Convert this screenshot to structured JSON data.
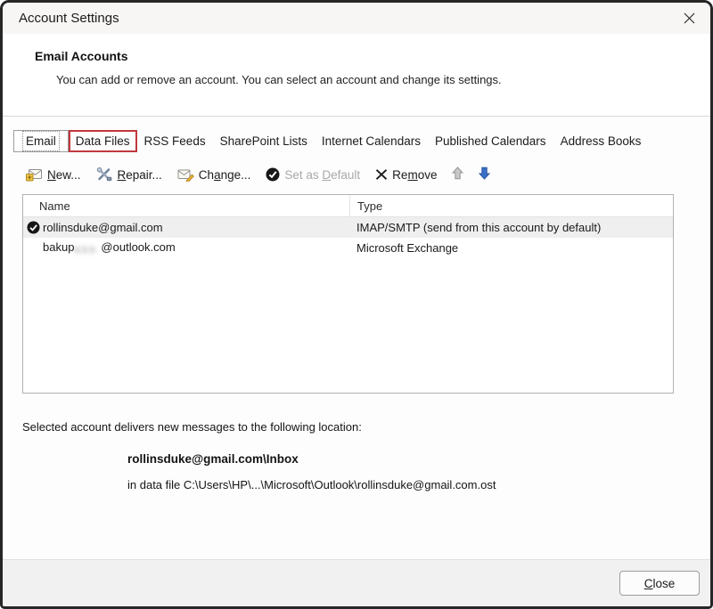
{
  "window": {
    "title": "Account Settings"
  },
  "header": {
    "title": "Email Accounts",
    "description": "You can add or remove an account. You can select an account and change its settings."
  },
  "tabs": [
    {
      "label": "Email",
      "selected": true
    },
    {
      "label": "Data Files",
      "annotated": true
    },
    {
      "label": "RSS Feeds"
    },
    {
      "label": "SharePoint Lists"
    },
    {
      "label": "Internet Calendars"
    },
    {
      "label": "Published Calendars"
    },
    {
      "label": "Address Books"
    }
  ],
  "toolbar": {
    "buttons": [
      {
        "pre": "",
        "key": "N",
        "post": "ew...",
        "icon": "new-account-icon",
        "enabled": true
      },
      {
        "pre": "",
        "key": "R",
        "post": "epair...",
        "icon": "repair-icon",
        "enabled": true
      },
      {
        "pre": "Ch",
        "key": "a",
        "post": "nge...",
        "icon": "change-icon",
        "enabled": true
      },
      {
        "pre": "Set as ",
        "key": "D",
        "post": "efault",
        "icon": "set-default-icon",
        "enabled": false
      },
      {
        "pre": "Re",
        "key": "m",
        "post": "ove",
        "icon": "remove-icon",
        "enabled": true
      }
    ]
  },
  "table": {
    "columns": [
      "Name",
      "Type"
    ],
    "rows": [
      {
        "name": "rollinsduke@gmail.com",
        "type": "IMAP/SMTP (send from this account by default)",
        "is_default": true,
        "selected": true
      },
      {
        "name_prefix": "bakup",
        "name_masked": "xxx",
        "name_suffix": "@outlook.com",
        "type": "Microsoft Exchange"
      }
    ]
  },
  "details": {
    "intro": "Selected account delivers new messages to the following location:",
    "location": "rollinsduke@gmail.com\\Inbox",
    "data_file": "in data file C:\\Users\\HP\\...\\Microsoft\\Outlook\\rollinsduke@gmail.com.ost"
  },
  "footer": {
    "close": {
      "pre": "",
      "key": "C",
      "post": "lose"
    }
  },
  "colors": {
    "annotation_red": "#c0393f",
    "arrow_blue": "#3a70c8",
    "selected_row_bg": "#efefef"
  }
}
